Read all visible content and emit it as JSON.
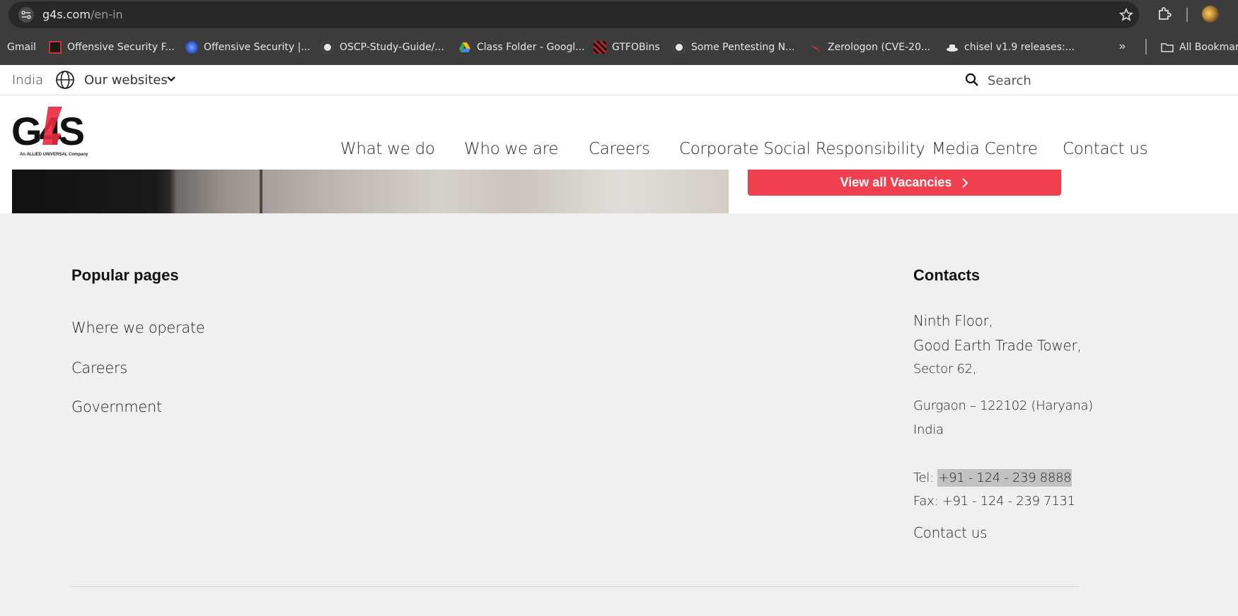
{
  "browser": {
    "url_host": "g4s.com",
    "url_path": "/en-in",
    "bookmarks": [
      {
        "label": "Gmail",
        "icon": "gmail-icon"
      },
      {
        "label": "Offensive Security F...",
        "icon": "offsec-icon"
      },
      {
        "label": "Offensive Security |...",
        "icon": "offsec-blue-icon"
      },
      {
        "label": "OSCP-Study-Guide/...",
        "icon": "github-icon"
      },
      {
        "label": "Class Folder - Googl...",
        "icon": "google-drive-icon"
      },
      {
        "label": "GTFOBins",
        "icon": "gtfobins-icon"
      },
      {
        "label": "Some Pentesting N...",
        "icon": "github-icon"
      },
      {
        "label": "Zerologon (CVE-20...",
        "icon": "bird-icon"
      },
      {
        "label": "chisel v1.9 releases:...",
        "icon": "hat-icon"
      }
    ],
    "all_bookmarks_label": "All Bookmarks"
  },
  "utility": {
    "country": "India",
    "websites_label": "Our websites",
    "search_placeholder": "Search"
  },
  "header": {
    "logo_text": "G4S",
    "logo_tagline": "An ALLIED UNIVERSAL Company",
    "nav": [
      "What we do",
      "Who we are",
      "Careers",
      "Corporate Social Responsibility",
      "Media Centre",
      "Contact us"
    ]
  },
  "hero": {
    "vacancies_button": "View all Vacancies"
  },
  "footer": {
    "popular_title": "Popular pages",
    "popular_links": [
      "Where we operate",
      "Careers",
      "Government"
    ],
    "contacts_title": "Contacts",
    "address_line1": "Ninth Floor,",
    "address_line2": "Good Earth Trade Tower,",
    "address_line3": "Sector 62,",
    "address_line4": "Gurgaon – 122102 (Haryana)",
    "address_line5": "India",
    "tel_label": "Tel: ",
    "tel_number": "+91 - 124 - 239 8888",
    "fax_label": "Fax: ",
    "fax_number": "+91 - 124 - 239 7131",
    "contact_link": "Contact us"
  },
  "colors": {
    "brand_red": "#f04050",
    "footer_bg": "#f0f0f0"
  }
}
